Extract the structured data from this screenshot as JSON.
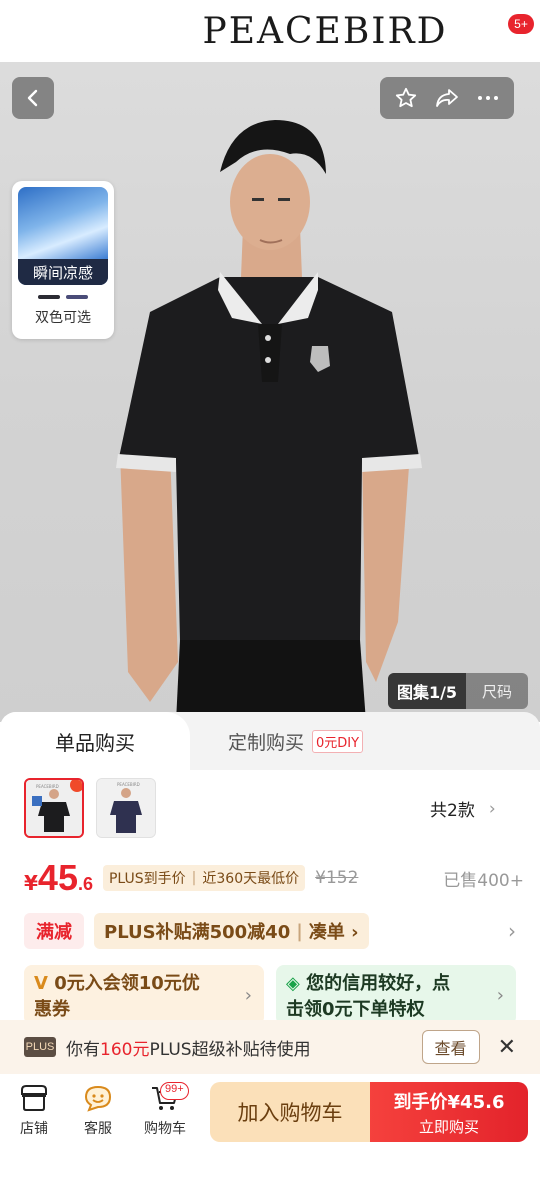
{
  "brand": {
    "name": "PEACEBIRD"
  },
  "top_actions": {
    "notification_badge": "5+"
  },
  "feature_card": {
    "caption": "瞬间凉感",
    "subtitle": "双色可选",
    "swatch_colors": [
      "#2b2b33",
      "#4a4c78"
    ]
  },
  "gallery": {
    "counter": "图集1/5",
    "size_tab": "尺码"
  },
  "tabs": {
    "single": "单品购买",
    "custom": "定制购买",
    "custom_tag": "0元DIY"
  },
  "variants": {
    "count_label": "共2款",
    "thumb_labels": [
      "PEACEBIRD",
      "PEACEBIRD"
    ]
  },
  "price": {
    "currency": "¥",
    "integer": "45",
    "decimal": ".6",
    "plus_label": "PLUS到手价",
    "lowest_label": "近360天最低价",
    "original": "¥152",
    "sold": "已售400+"
  },
  "promo": {
    "label": "满减",
    "text": "PLUS补贴满500减40",
    "extra": "凑单 ›"
  },
  "coupons": {
    "c1_line1": "0元入会领10元优",
    "c1_line2": "惠券",
    "c2_line1": "您的信用较好，点",
    "c2_line2": "击领0元下单特权"
  },
  "plus_bar": {
    "logo": "PLUS",
    "prefix": "你有",
    "amount": "160元",
    "suffix": "PLUS超级补贴待使用",
    "view": "查看"
  },
  "bottom": {
    "store": "店铺",
    "service": "客服",
    "cart": "购物车",
    "cart_badge": "99+",
    "add_to_cart": "加入购物车",
    "buy_price": "到手价¥45.6",
    "buy_now": "立即购买"
  },
  "colors": {
    "accent_red": "#e8242d",
    "gold_bg": "#fbe0b9"
  }
}
